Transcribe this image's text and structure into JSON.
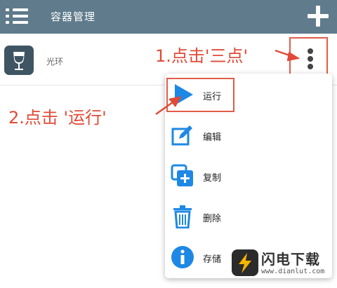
{
  "app_bar": {
    "title": "容器管理",
    "menu_icon": "hamburger-list-icon",
    "add_icon": "plus-icon",
    "background_color": "#5f7b8c"
  },
  "container_row": {
    "label": "光环",
    "icon": "wine-glass-icon",
    "more_icon": "more-vertical-icon"
  },
  "popup_menu": {
    "items": [
      {
        "label": "运行",
        "icon": "play-icon",
        "color": "#1e88e5"
      },
      {
        "label": "编辑",
        "icon": "edit-icon",
        "color": "#1e88e5"
      },
      {
        "label": "复制",
        "icon": "copy-icon",
        "color": "#1e88e5"
      },
      {
        "label": "删除",
        "icon": "trash-icon",
        "color": "#1e88e5"
      },
      {
        "label": "存储",
        "icon": "info-icon",
        "color": "#1e88e5"
      }
    ]
  },
  "annotations": {
    "step1": "1.点击'三点'",
    "step2": "2.点击 '运行'",
    "color": "#e04a36"
  },
  "watermark": {
    "brand": "闪电下载",
    "url": "www.dianlut.com"
  }
}
